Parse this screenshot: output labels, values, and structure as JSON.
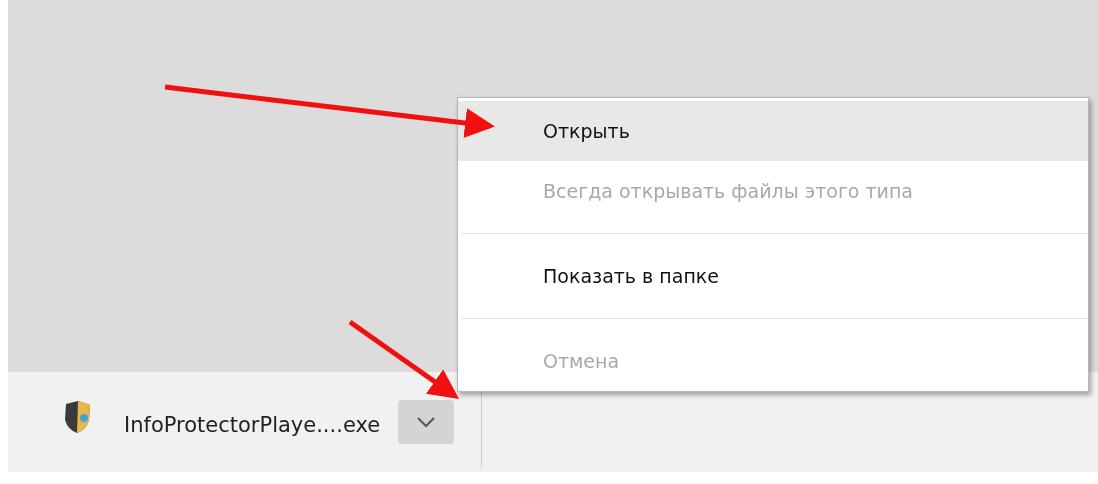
{
  "download_bar": {
    "file_name": "InfoProtectorPlaye....exe"
  },
  "context_menu": {
    "groups": [
      [
        {
          "label": "Открыть",
          "selected": true,
          "disabled": false
        },
        {
          "label": "Всегда открывать файлы этого типа",
          "selected": false,
          "disabled": true
        }
      ],
      [
        {
          "label": "Показать в папке",
          "selected": false,
          "disabled": false
        }
      ],
      [
        {
          "label": "Отмена",
          "selected": false,
          "disabled": true
        }
      ]
    ]
  }
}
